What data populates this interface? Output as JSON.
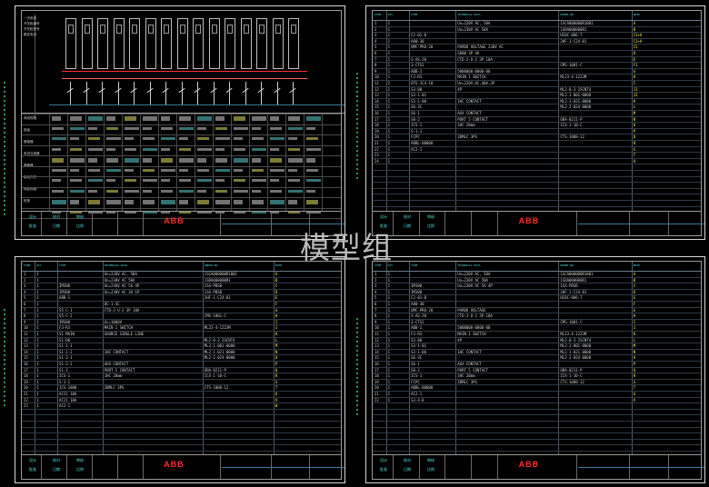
{
  "watermark": "模型组",
  "sheets": [
    {
      "id": "sheet-1",
      "kind": "single-line-diagram",
      "logo": "ABB",
      "row_labels": [
        "一次系统",
        "开关柜编号",
        "开关柜型号",
        "额定电流",
        "母线规格",
        "用途",
        "断路器",
        "电流互感器",
        "避雷器",
        "接地开关",
        "电缆规格",
        "柜宽"
      ],
      "tb_fields": [
        "设计",
        "校对",
        "审核",
        "批准",
        "日期",
        "比例"
      ]
    },
    {
      "id": "sheet-2",
      "kind": "parts-list",
      "logo": "ABB",
      "headers": [
        "ITEM",
        "QTY",
        "TYPE",
        "TECHNICAL DATA",
        "ORDER NO.",
        "NOTE"
      ],
      "rows": [
        [
          "1",
          "1",
          "",
          "Un=220V AC, 50A",
          "1SCA000000R1001",
          "A"
        ],
        [
          "2",
          "1",
          "",
          "Un=230V AC 50A",
          "1SDA000000R1",
          "B"
        ],
        [
          "3",
          "1",
          "C2-01-B",
          "",
          "HI0C-006-T",
          "C1+A"
        ],
        [
          "4",
          "1",
          "A80-30",
          "",
          "2HF-1-C24-01",
          "C1+A"
        ],
        [
          "5",
          "1",
          "UMC-PRO-20",
          "PARDO VOLTAGE 230V AC",
          "",
          "C2"
        ],
        [
          "6",
          "1",
          "",
          "S800 3P 4A",
          "",
          "D"
        ],
        [
          "7",
          "1",
          "S-AS-20",
          "CTD-2-U-2 3P 10A",
          "",
          "E"
        ],
        [
          "8",
          "1",
          "3-CTS2",
          "",
          "CMS-1001-C",
          "F1"
        ],
        [
          "9",
          "1",
          "ABB-1",
          "5000000-0000-00",
          "",
          "G"
        ],
        [
          "10",
          "1",
          "F3-R3",
          "MAIN 1 SWITCH",
          "ML23-4-1223M",
          "H"
        ],
        [
          "11",
          "2",
          "OTE-1C4-10",
          "Ue=220V,AC,40A,3P",
          "",
          "I"
        ],
        [
          "12",
          "1",
          "S3-00",
          "4P",
          "ML2-0-3 2SCNT4",
          "J1"
        ],
        [
          "13",
          "1",
          "S3-1-01",
          "",
          "ML2-1-001-0000",
          "J2"
        ],
        [
          "14",
          "1",
          "S3-1-00",
          "1HC CONTACT",
          "ML2-1-021-0000",
          "K"
        ],
        [
          "15",
          "1",
          "S6-3C",
          "",
          "ML2-2-024-0000",
          "L"
        ],
        [
          "16",
          "1",
          "S6-1",
          "AUX CONTACT",
          "",
          "M"
        ],
        [
          "17",
          "1",
          "S8-2",
          "PORT 5 CONTACT",
          "OBA-0211-P",
          "N"
        ],
        [
          "18",
          "1",
          "ICS-1",
          "1HC 20mm",
          "ICX-1-10-C",
          "O"
        ],
        [
          "19",
          "1",
          "S-1-1",
          "",
          "",
          "P"
        ],
        [
          "20",
          "1",
          "FCPC",
          "2BMLC 3PS",
          "CTS-1008-12",
          "Q"
        ],
        [
          "21",
          "1",
          "ABBL-00000",
          "",
          "",
          "R"
        ],
        [
          "22",
          "1",
          "AC2-1",
          "",
          "",
          "S"
        ],
        [
          "23",
          "1",
          "",
          "",
          "",
          "T"
        ],
        [
          "24",
          "1",
          "",
          "",
          "",
          "U"
        ]
      ],
      "tb_fields": [
        "设计",
        "校对",
        "审核",
        "批准",
        "日期",
        "比例"
      ]
    },
    {
      "id": "sheet-3",
      "kind": "parts-list",
      "logo": "ABB",
      "headers": [
        "ITEM",
        "QTY",
        "TYPE",
        "TECHNICAL DATA",
        "ORDER NO.",
        "NOTE"
      ],
      "rows": [
        [
          "1",
          "1",
          "",
          "Un=220V AC, 50A",
          "1SCA000000R1001",
          "A"
        ],
        [
          "2",
          "1",
          "",
          "Un=230V AC 50A",
          "1SDA000000R1",
          "B"
        ],
        [
          "3",
          "1",
          "IM300",
          "Un=230V AC 5A 4P",
          "1SA-PBSB",
          "C"
        ],
        [
          "4",
          "1",
          "IM300",
          "Un=230V AC 3A 1P",
          "1SA-PBSB",
          "D"
        ],
        [
          "5",
          "1",
          "ABB-1",
          "",
          "2HF-1-C24-01",
          "E"
        ],
        [
          "6",
          "1",
          "",
          "DC-1 SC",
          "",
          "F"
        ],
        [
          "7",
          "1",
          "S5-C-1",
          "CTD-2-U-2 3P 10A",
          "",
          "G"
        ],
        [
          "8",
          "1",
          "S5-C-2",
          "",
          "CMS-1001-C",
          "H"
        ],
        [
          "9",
          "1",
          "IM300",
          "Uc=1000V",
          "",
          "I"
        ],
        [
          "10",
          "1",
          "F3-R3",
          "MAIN 1 SWITCH",
          "ML23-4-1223M",
          "J"
        ],
        [
          "11",
          "1",
          "S1 MAIN",
          "SOURCE SINGLE LINE",
          "",
          "K"
        ],
        [
          "12",
          "1",
          "S1-D0",
          "",
          "ML2-0-3 2SCNT4",
          "L"
        ],
        [
          "13",
          "1",
          "S1-1-1",
          "",
          "ML2-1-001-0000",
          "M"
        ],
        [
          "14",
          "1",
          "S1-1-2",
          "1HC CONTACT",
          "ML2-1-021-0000",
          "N"
        ],
        [
          "15",
          "1",
          "S1-2-1",
          "",
          "ML2-2-024-0000",
          "O"
        ],
        [
          "16",
          "1",
          "S1-2-2",
          "AUX CONTACT",
          "",
          "P"
        ],
        [
          "17",
          "1",
          "S1-3",
          "PORT 5 CONTACT",
          "OBA-0211-P",
          "Q"
        ],
        [
          "18",
          "1",
          "ICS-1",
          "1HC 20mm",
          "ICX-1-10-C",
          "R"
        ],
        [
          "19",
          "1",
          "S-1-1",
          "",
          "",
          "S"
        ],
        [
          "20",
          "1",
          "ICS-1000",
          "2BMLC 3PS",
          "CTS-1008-12",
          "T"
        ],
        [
          "21",
          "1",
          "AC21 10A",
          "",
          "",
          "U"
        ],
        [
          "22",
          "1",
          "AC21 10A",
          "",
          "",
          "V"
        ],
        [
          "23",
          "1",
          "AC2-1",
          "",
          "",
          "W"
        ]
      ],
      "tb_fields": [
        "设计",
        "校对",
        "审核",
        "批准",
        "日期",
        "比例"
      ]
    },
    {
      "id": "sheet-4",
      "kind": "parts-list",
      "logo": "ABB",
      "headers": [
        "ITEM",
        "QTY",
        "TYPE",
        "TECHNICAL DATA",
        "ORDER NO.",
        "NOTE"
      ],
      "rows": [
        [
          "1",
          "1",
          "",
          "Un=220V AC, 50A",
          "1SCA000000R1001",
          "A"
        ],
        [
          "2",
          "1",
          "",
          "Un=230V AC 50A",
          "1SDA000000R1",
          "B"
        ],
        [
          "3",
          "1",
          "IM300",
          "Un=230V AC 5A 4P",
          "1SA-PBSB",
          "C"
        ],
        [
          "4",
          "1",
          "IM300",
          "",
          "2HF-1-C24-01",
          "D"
        ],
        [
          "5",
          "1",
          "C2-01-B",
          "",
          "HI0C-006-T",
          "E"
        ],
        [
          "6",
          "1",
          "A80-30",
          "",
          "",
          "F"
        ],
        [
          "7",
          "1",
          "UMC-PRO-20",
          "PARDO VOLTAGE",
          "",
          "G"
        ],
        [
          "8",
          "1",
          "S-AS-20",
          "CTD-2-U-2 3P 10A",
          "",
          "H"
        ],
        [
          "9",
          "1",
          "3-CTS2",
          "",
          "CMS-1001-C",
          "I"
        ],
        [
          "10",
          "1",
          "ABB-1",
          "5000000-0000-00",
          "",
          "J"
        ],
        [
          "11",
          "1",
          "F3-R3",
          "MAIN 1 SWITCH",
          "ML23-4-1223M",
          "K"
        ],
        [
          "12",
          "1",
          "S3-00",
          "4P",
          "ML2-0-3 2SCNT4",
          "L"
        ],
        [
          "13",
          "1",
          "S3-1-01",
          "",
          "ML2-1-001-0000",
          "M"
        ],
        [
          "14",
          "1",
          "S3-1-00",
          "1HC CONTACT",
          "ML2-1-021-0000",
          "N"
        ],
        [
          "15",
          "1",
          "S6-3C",
          "",
          "ML2-2-024-0000",
          "O"
        ],
        [
          "16",
          "1",
          "S6-1",
          "AUX CONTACT",
          "",
          "P"
        ],
        [
          "17",
          "1",
          "S8-2",
          "PORT 5 CONTACT",
          "OBA-0211-P",
          "Q"
        ],
        [
          "18",
          "1",
          "ICS-1",
          "1HC 20mm",
          "ICX-1-10-C",
          "R"
        ],
        [
          "19",
          "1",
          "FCPC",
          "2BMLC 3PS",
          "CTS-1008-12",
          "S"
        ],
        [
          "20",
          "1",
          "ABBL-00000",
          "",
          "",
          "T"
        ],
        [
          "21",
          "1",
          "AC2-1",
          "",
          "",
          "U"
        ],
        [
          "22",
          "1",
          "S3-4-B",
          "",
          "",
          "V"
        ]
      ],
      "tb_fields": [
        "设计",
        "校对",
        "审核",
        "批准",
        "日期",
        "比例"
      ]
    }
  ]
}
